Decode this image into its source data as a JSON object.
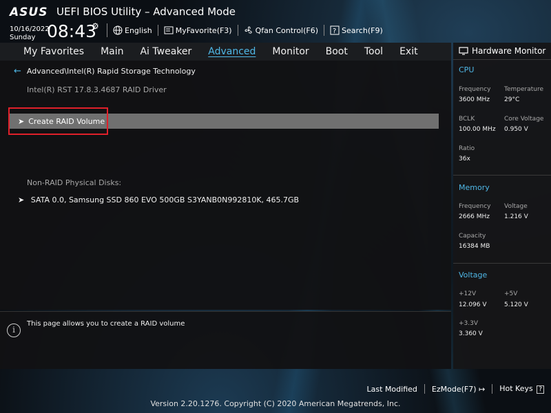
{
  "header": {
    "brand": "ASUS",
    "title": "UEFI BIOS Utility – Advanced Mode",
    "date": "10/16/2022",
    "day": "Sunday",
    "time": "08:43",
    "toolbar": {
      "language": "English",
      "my_favorite": "MyFavorite(F3)",
      "qfan": "Qfan Control(F6)",
      "search": "Search(F9)"
    }
  },
  "nav": {
    "tabs": [
      "My Favorites",
      "Main",
      "Ai Tweaker",
      "Advanced",
      "Monitor",
      "Boot",
      "Tool",
      "Exit"
    ],
    "active": "Advanced"
  },
  "main": {
    "breadcrumb": "Advanced\\Intel(R) Rapid Storage Technology",
    "driver": "Intel(R) RST 17.8.3.4687 RAID Driver",
    "create_raid": "Create RAID Volume",
    "non_raid_label": "Non-RAID Physical Disks:",
    "disk": "SATA 0.0, Samsung SSD 860 EVO 500GB S3YANB0N992810K, 465.7GB"
  },
  "help": {
    "text": "This page allows you to create a RAID volume"
  },
  "hardware_monitor": {
    "title": "Hardware Monitor",
    "cpu": {
      "heading": "CPU",
      "frequency_label": "Frequency",
      "frequency": "3600 MHz",
      "temperature_label": "Temperature",
      "temperature": "29°C",
      "bclk_label": "BCLK",
      "bclk": "100.00 MHz",
      "core_voltage_label": "Core Voltage",
      "core_voltage": "0.950 V",
      "ratio_label": "Ratio",
      "ratio": "36x"
    },
    "memory": {
      "heading": "Memory",
      "frequency_label": "Frequency",
      "frequency": "2666 MHz",
      "voltage_label": "Voltage",
      "voltage": "1.216 V",
      "capacity_label": "Capacity",
      "capacity": "16384 MB"
    },
    "voltage": {
      "heading": "Voltage",
      "v12_label": "+12V",
      "v12": "12.096 V",
      "v5_label": "+5V",
      "v5": "5.120 V",
      "v33_label": "+3.3V",
      "v33": "3.360 V"
    }
  },
  "footer": {
    "last_modified": "Last Modified",
    "ezmode": "EzMode(F7)",
    "hot_keys": "Hot Keys",
    "hot_keys_key": "?",
    "version": "Version 2.20.1276. Copyright (C) 2020 American Megatrends, Inc."
  },
  "colors": {
    "accent": "#4fb7e6",
    "highlight_row": "#707070",
    "annotation_box": "#e0202a"
  }
}
